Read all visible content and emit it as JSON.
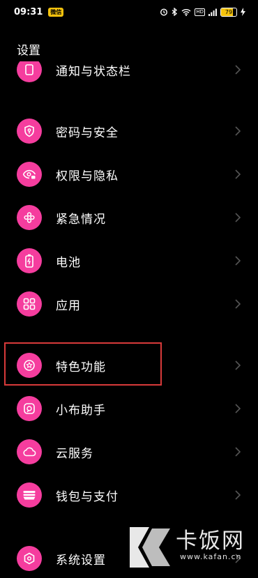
{
  "status_bar": {
    "time": "09:31",
    "badge": "微信",
    "network_label": "HD",
    "battery": "79",
    "battery_level": 0.79
  },
  "page_title": "设置",
  "menu": {
    "partial_top": "通知与状态栏",
    "items": [
      {
        "label": "密码与安全",
        "icon": "shield-key-icon"
      },
      {
        "label": "权限与隐私",
        "icon": "eye-lock-icon"
      },
      {
        "label": "紧急情况",
        "icon": "asterisk-icon"
      },
      {
        "label": "电池",
        "icon": "battery-icon"
      },
      {
        "label": "应用",
        "icon": "apps-grid-icon"
      },
      {
        "label": "特色功能",
        "icon": "star-badge-icon"
      },
      {
        "label": "小布助手",
        "icon": "assistant-icon"
      },
      {
        "label": "云服务",
        "icon": "cloud-icon"
      },
      {
        "label": "钱包与支付",
        "icon": "wallet-icon"
      },
      {
        "label": "系统设置",
        "icon": "hexagon-settings-icon"
      }
    ]
  },
  "watermark": {
    "text": "卡饭网",
    "url": "www.kafan.cn"
  },
  "colors": {
    "accent": "#f53d9e",
    "highlight": "#d83a3a",
    "background": "#000000"
  }
}
